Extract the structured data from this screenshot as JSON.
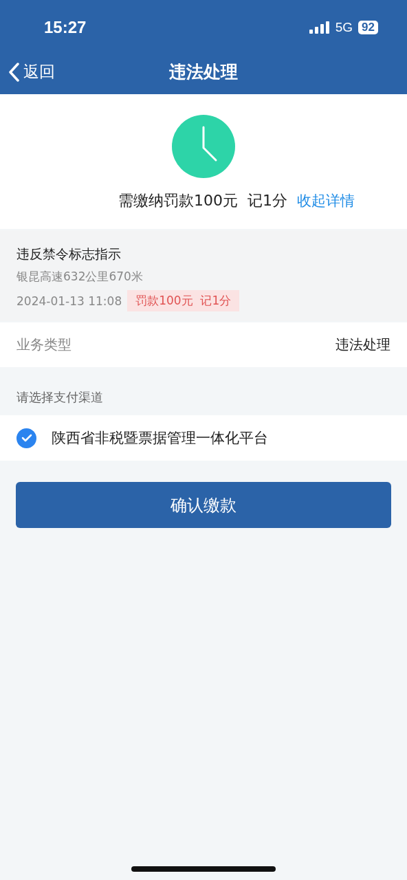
{
  "status_bar": {
    "time": "15:27",
    "network": "5G",
    "battery": "92"
  },
  "nav": {
    "back": "返回",
    "title": "违法处理"
  },
  "summary": {
    "fine": "需缴纳罚款100元",
    "points": "记1分",
    "toggle": "收起详情"
  },
  "violation": {
    "title": "违反禁令标志指示",
    "location": "银昆高速632公里670米",
    "time": "2024-01-13 11:08",
    "tag": "罚款100元  记1分"
  },
  "business": {
    "label": "业务类型",
    "value": "违法处理"
  },
  "payment": {
    "title": "请选择支付渠道",
    "options": [
      {
        "label": "陕西省非税暨票据管理一体化平台",
        "selected": true
      }
    ]
  },
  "confirm_button": "确认缴款"
}
